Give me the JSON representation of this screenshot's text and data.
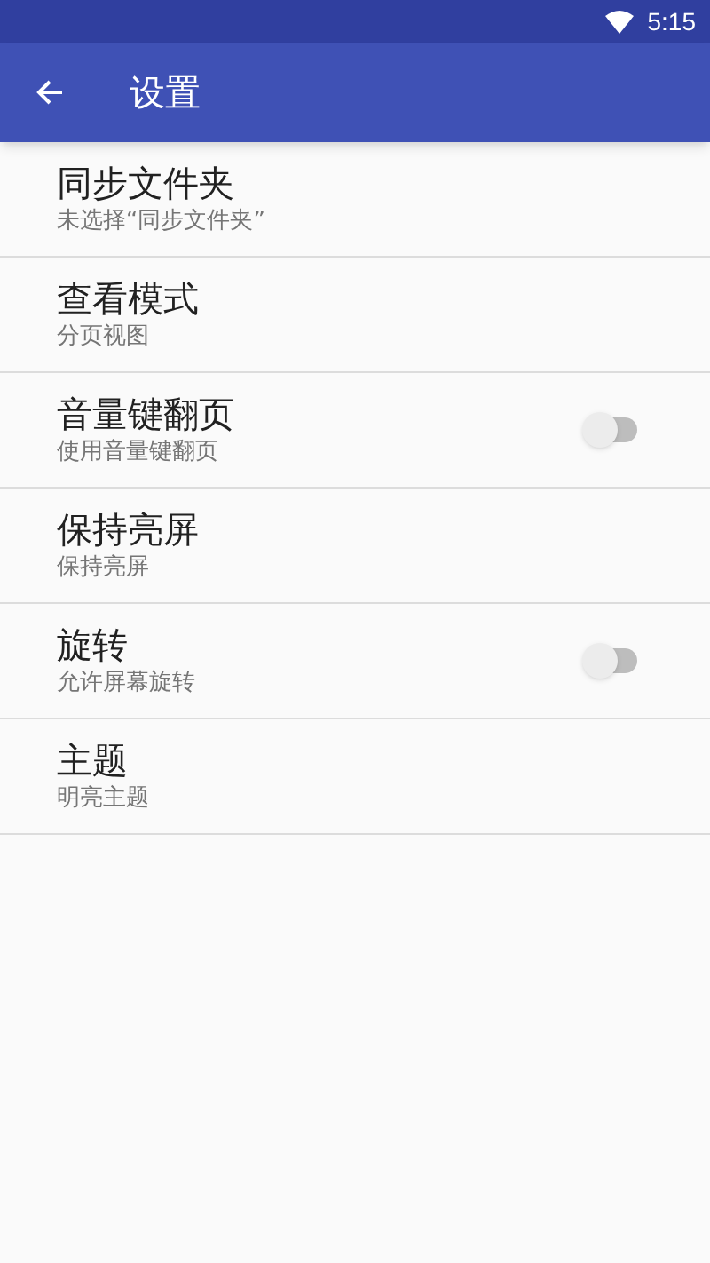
{
  "status_bar": {
    "time": "5:15"
  },
  "app_bar": {
    "title": "设置"
  },
  "settings": [
    {
      "kind": "text",
      "title": "同步文件夹",
      "summary": "未选择“同步文件夹”"
    },
    {
      "kind": "text",
      "title": "查看模式",
      "summary": "分页视图"
    },
    {
      "kind": "toggle",
      "title": "音量键翻页",
      "summary": "使用音量键翻页",
      "on": false
    },
    {
      "kind": "text",
      "title": "保持亮屏",
      "summary": "保持亮屏"
    },
    {
      "kind": "toggle",
      "title": "旋转",
      "summary": "允许屏幕旋转",
      "on": false
    },
    {
      "kind": "text",
      "title": "主题",
      "summary": "明亮主题"
    }
  ]
}
